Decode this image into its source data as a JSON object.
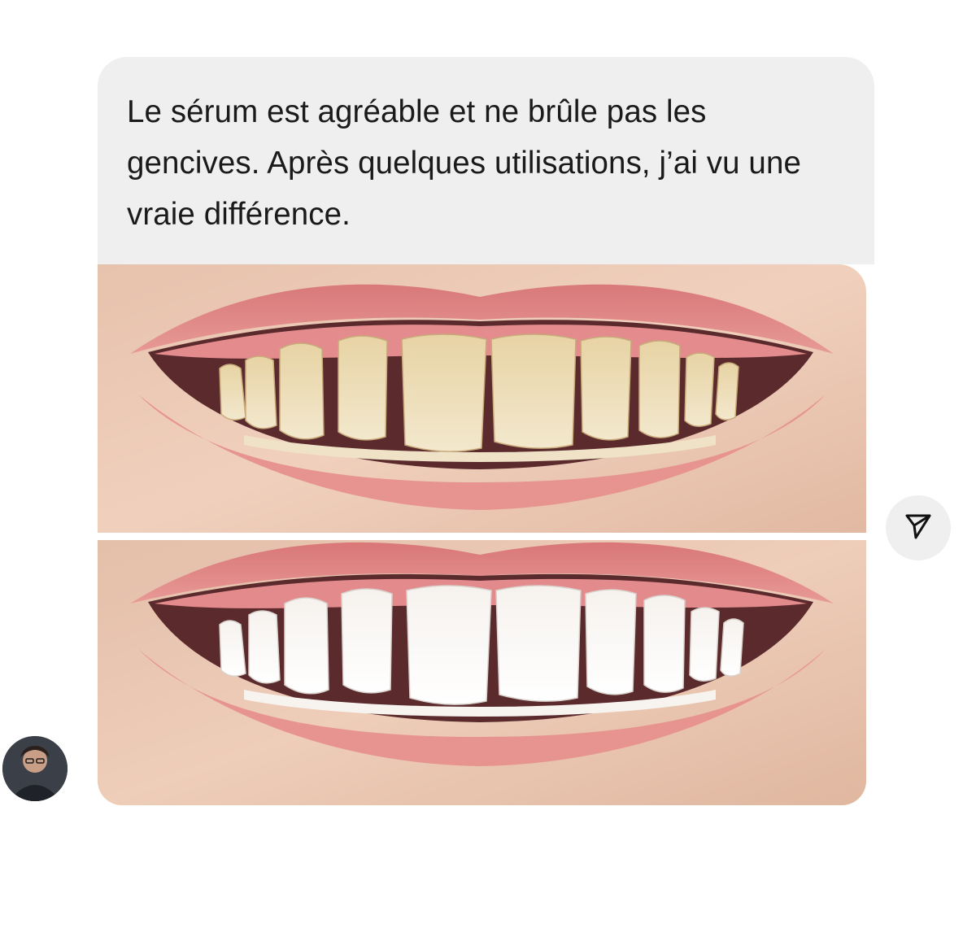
{
  "message": {
    "text": "Le sérum est agréable et ne brûle pas les gencives. Après quelques utilisations, j’ai vu une vraie différence."
  },
  "attachment": {
    "image": "teeth-whitening-before-after-photo"
  },
  "actions": {
    "share_icon": "paper-plane-icon"
  },
  "sender": {
    "avatar": "user-avatar-photo"
  },
  "colors": {
    "bubble_bg": "#efefef",
    "text": "#1a1a1a",
    "page_bg": "#ffffff"
  }
}
